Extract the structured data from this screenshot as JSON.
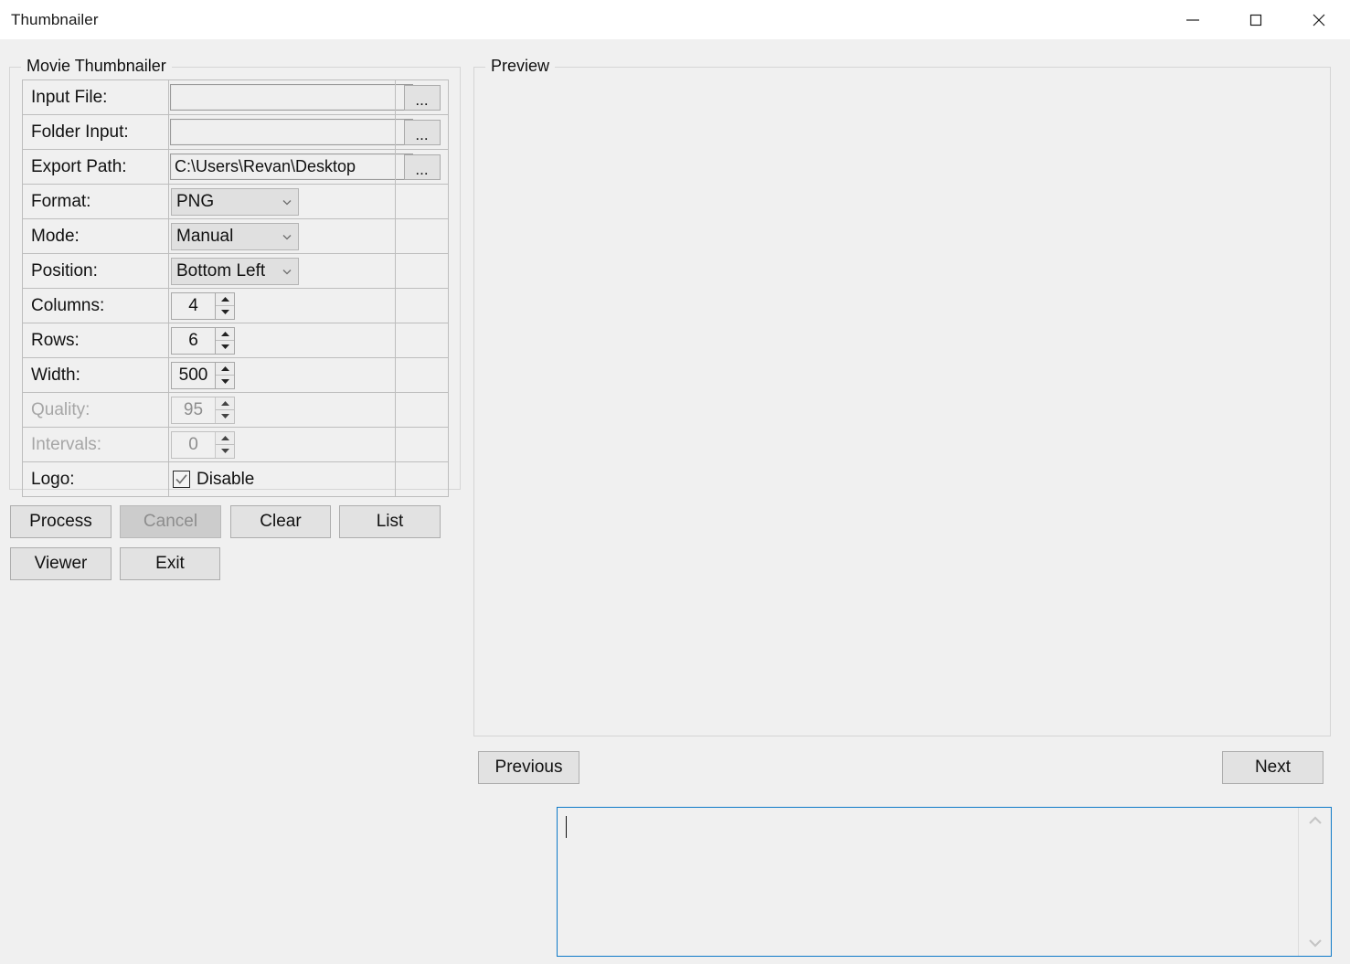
{
  "window": {
    "title": "Thumbnailer",
    "controls": [
      {
        "name": "minimize-button",
        "glyph": "minimize"
      },
      {
        "name": "maximize-button",
        "glyph": "maximize"
      },
      {
        "name": "close-button",
        "glyph": "close"
      }
    ]
  },
  "form_group": {
    "legend": "Movie Thumbnailer",
    "rows": [
      {
        "label": "Input File:",
        "type": "text",
        "value": "",
        "placeholder": "",
        "browse": "...",
        "disabled": false
      },
      {
        "label": "Folder Input:",
        "type": "text",
        "value": "",
        "placeholder": "",
        "browse": "...",
        "disabled": false
      },
      {
        "label": "Export Path:",
        "type": "text",
        "value": "C:\\Users\\Revan\\Desktop",
        "placeholder": "",
        "browse": "...",
        "disabled": false
      },
      {
        "label": "Format:",
        "type": "combo",
        "value": "PNG",
        "disabled": false
      },
      {
        "label": "Mode:",
        "type": "combo",
        "value": "Manual",
        "disabled": false
      },
      {
        "label": "Position:",
        "type": "combo",
        "value": "Bottom Left",
        "disabled": false
      },
      {
        "label": "Columns:",
        "type": "spinner",
        "value": "4",
        "disabled": false
      },
      {
        "label": "Rows:",
        "type": "spinner",
        "value": "6",
        "disabled": false
      },
      {
        "label": "Width:",
        "type": "spinner",
        "value": "500",
        "disabled": false
      },
      {
        "label": "Quality:",
        "type": "spinner",
        "value": "95",
        "disabled": true
      },
      {
        "label": "Intervals:",
        "type": "spinner",
        "value": "0",
        "disabled": true
      },
      {
        "label": "Logo:",
        "type": "checkbox",
        "value": "Disable",
        "checked": true,
        "disabled": false
      }
    ]
  },
  "actions": {
    "process": "Process",
    "cancel": "Cancel",
    "cancel_disabled": true,
    "clear": "Clear",
    "list": "List",
    "viewer": "Viewer",
    "exit": "Exit"
  },
  "preview_group": {
    "legend": "Preview",
    "previous": "Previous",
    "next": "Next"
  },
  "log": {
    "value": "",
    "placeholder": ""
  },
  "colors": {
    "window_background": "#f0f0f0",
    "titlebar_background": "#ffffff",
    "focus_border": "#0f7ac8",
    "button_face": "#e2e2e2",
    "button_disabled": "#cccccc",
    "text": "#111111",
    "text_disabled": "#a6a6a6",
    "group_border": "#d5d5d5",
    "grid_border": "#bdbdbd"
  }
}
